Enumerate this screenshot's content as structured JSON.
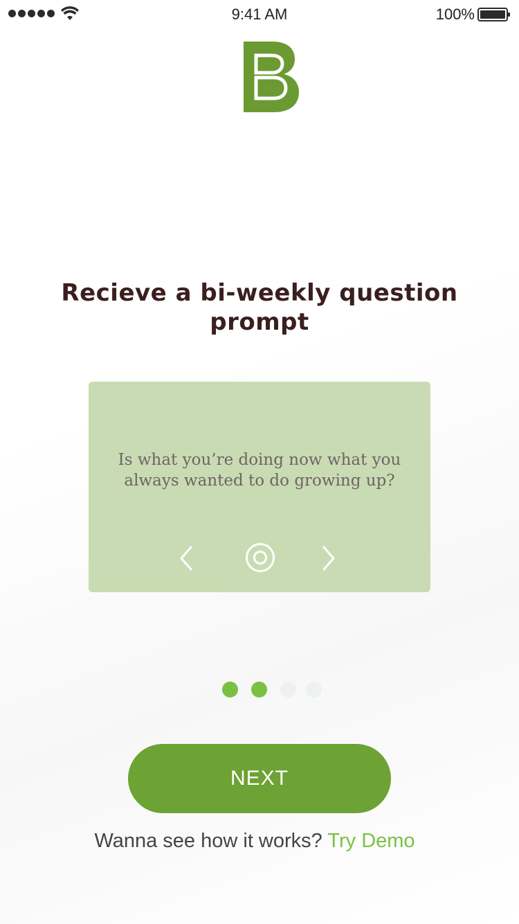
{
  "status_bar": {
    "time": "9:41 AM",
    "battery_percent": "100%",
    "signal_icon": "signal-dots-icon",
    "wifi_icon": "wifi-icon",
    "battery_icon": "battery-icon"
  },
  "logo": {
    "icon": "b-logo-icon",
    "color": "#6a9a31"
  },
  "onboarding": {
    "title": "Recieve a bi-weekly question prompt",
    "card": {
      "question": "Is what you’re doing now what you always wanted to do growing up?",
      "background": "#c9dbb3",
      "prev_icon": "chevron-left-icon",
      "record_icon": "record-icon",
      "next_icon": "chevron-right-icon"
    },
    "pager": {
      "total": 4,
      "active_count": 2
    }
  },
  "next_button": {
    "label": "NEXT",
    "color": "#6da234"
  },
  "footer": {
    "text": "Wanna see how it works?",
    "link": "Try Demo",
    "link_color": "#7ac143"
  }
}
